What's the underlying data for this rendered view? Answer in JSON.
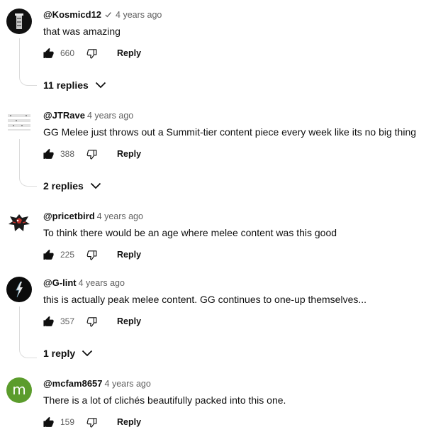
{
  "comments": [
    {
      "author": "@Kosmicd12",
      "verified": true,
      "time": "4 years ago",
      "text": "that was amazing",
      "likes": "660",
      "reply": "Reply",
      "replies": "11 replies",
      "avatar": "tower",
      "avatar_bg": "#111111"
    },
    {
      "author": "@JTRave",
      "verified": false,
      "time": "4 years ago",
      "text": "GG Melee just throws out a Summit-tier content piece every week like its no big thing",
      "likes": "388",
      "reply": "Reply",
      "replies": "2 replies",
      "avatar": "sheet",
      "avatar_bg": "#ffffff"
    },
    {
      "author": "@pricetbird",
      "verified": false,
      "time": "4 years ago",
      "text": "To think there would be an age where melee content was this good",
      "likes": "225",
      "reply": "Reply",
      "replies": "",
      "avatar": "bird",
      "avatar_bg": "#ffffff"
    },
    {
      "author": "@G-lint",
      "verified": false,
      "time": "4 years ago",
      "text": "this is actually peak melee content. GG continues to one-up themselves...",
      "likes": "357",
      "reply": "Reply",
      "replies": "1 reply",
      "avatar": "bolt",
      "avatar_bg": "#0b0b0b"
    },
    {
      "author": "@mcfam8657",
      "verified": false,
      "time": "4 years ago",
      "text": "There is a lot of clichés beautifully packed into this one.",
      "likes": "159",
      "reply": "Reply",
      "replies": "",
      "avatar": "m",
      "avatar_bg": "#5b9c2c"
    }
  ]
}
